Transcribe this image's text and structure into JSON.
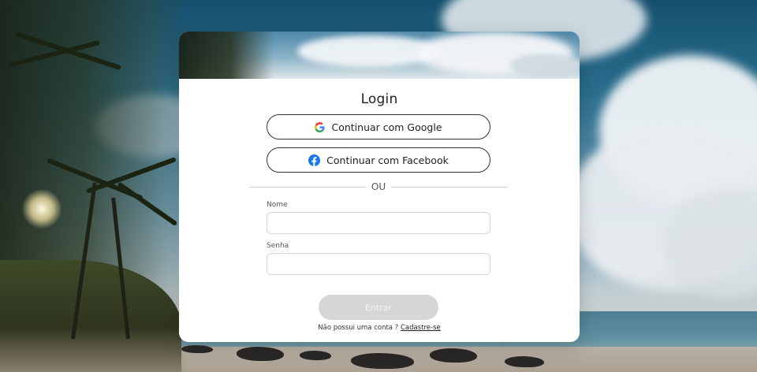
{
  "login": {
    "title": "Login",
    "google_button": "Continuar com Google",
    "facebook_button": "Continuar com Facebook",
    "divider_text": "OU",
    "name_label": "Nome",
    "name_value": "",
    "password_label": "Senha",
    "password_value": "",
    "submit_label": "Entrar",
    "signup_prompt": "Não possui uma conta ?",
    "signup_link": "Cadastre-se"
  },
  "icons": {
    "google": "google-icon",
    "facebook": "facebook-icon"
  },
  "colors": {
    "facebook_blue": "#1877F2",
    "submit_disabled": "#D6D6D6",
    "card_background": "#FFFFFF"
  }
}
